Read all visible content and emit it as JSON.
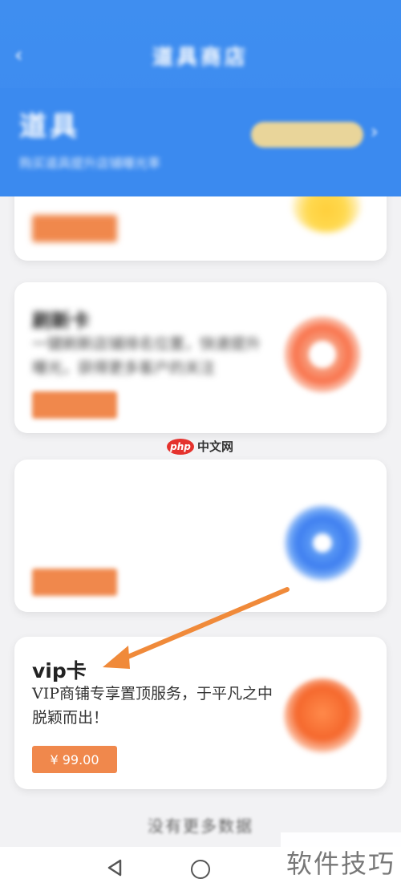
{
  "status_bar": {
    "left": "",
    "right": ""
  },
  "header": {
    "back": "‹",
    "title": "道具商店",
    "hero_title": "道具",
    "hero_subtitle": "购买道具提升店铺曝光率",
    "hero_button": "",
    "chevron": "›"
  },
  "cards": [
    {
      "title": "",
      "desc": "",
      "price": "",
      "icon": "coin"
    },
    {
      "title": "刷新卡",
      "desc": "一键刷新店铺排名位置，快速提升曝光，获得更多客户的关注",
      "price": "",
      "icon": "refresh"
    },
    {
      "title": "",
      "desc": "",
      "price": "",
      "icon": "target"
    },
    {
      "title": "vip卡",
      "desc": "VIP商铺专享置顶服务，于平凡之中脱颖而出！",
      "price": "¥ 99.00",
      "icon": "vip"
    }
  ],
  "watermark": {
    "php": "php",
    "cn": "中文网",
    "corner": "软件技巧"
  },
  "footer": {
    "no_more": "没有更多数据"
  },
  "colors": {
    "primary": "#3d8cf0",
    "price": "#f0884c",
    "arrow": "#f08a3a"
  }
}
